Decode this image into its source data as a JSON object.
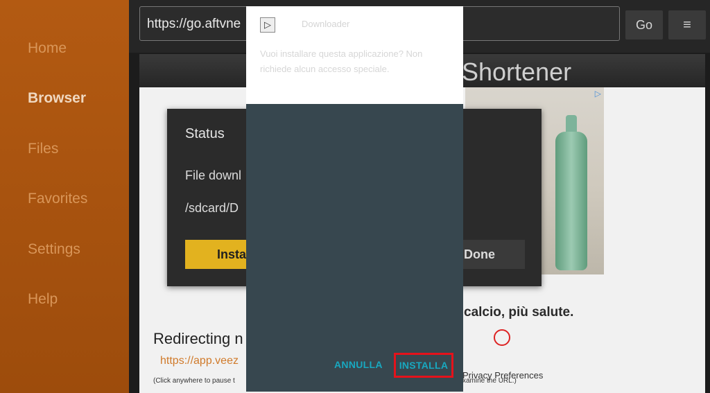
{
  "sidebar": {
    "items": [
      {
        "label": "Home"
      },
      {
        "label": "Browser"
      },
      {
        "label": "Files"
      },
      {
        "label": "Favorites"
      },
      {
        "label": "Settings"
      },
      {
        "label": "Help"
      }
    ],
    "active": "Browser"
  },
  "toolbar": {
    "url": "https://go.aftvne",
    "go_label": "Go",
    "menu_icon": "≡"
  },
  "webpage": {
    "header_title": "Shortener",
    "ad_tagline": "calcio, più salute.",
    "redirecting_label": "Redirecting n",
    "redirect_url": "https://app.veez",
    "click_note": "(Click anywhere to pause t",
    "privacy_label": "Privacy Preferences",
    "examine_note": "xamine the URL.)"
  },
  "status_dialog": {
    "title": "Status",
    "line1": "File downl",
    "line2": "/sdcard/D",
    "install_label": "Insta",
    "done_label": "Done"
  },
  "installer": {
    "app_name": "Downloader",
    "prompt": "Vuoi installare questa applicazione? Non richiede alcun accesso speciale.",
    "cancel_label": "ANNULLA",
    "install_label": "INSTALLA"
  },
  "colors": {
    "sidebar": "#a8520f",
    "installer_bg": "#37474f",
    "accent_teal": "#18a8c0",
    "highlight_red": "#e5121b",
    "install_yellow": "#e2b21f"
  }
}
